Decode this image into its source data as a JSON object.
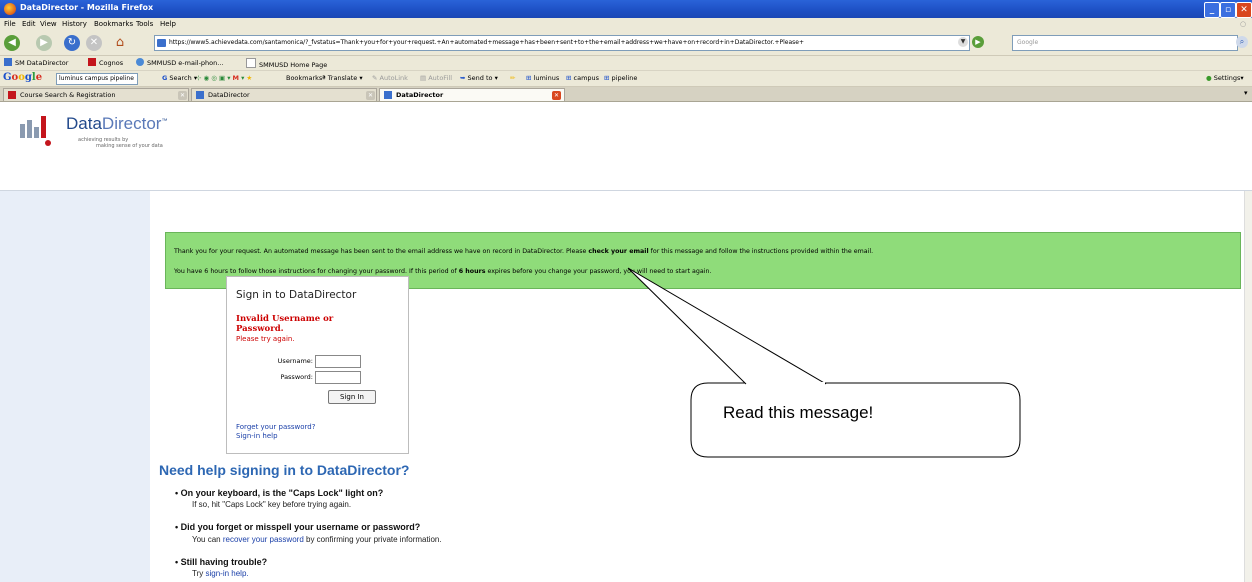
{
  "window": {
    "title": "DataDirector - Mozilla Firefox"
  },
  "menu": [
    "File",
    "Edit",
    "View",
    "History",
    "Bookmarks",
    "Tools",
    "Help"
  ],
  "nav": {
    "url": "https://www5.achievedata.com/santamonica/?_fvstatus=Thank+you+for+your+request.+An+automated+message+has+been+sent+to+the+email+address+we+have+on+record+in+DataDirector.+Please+",
    "search_placeholder": "Google"
  },
  "bookmarks": [
    "SM DataDirector",
    "Cognos",
    "SMMUSD e-mail-phon...",
    "SMMUSD Home Page"
  ],
  "google_toolbar": {
    "logo": "Google",
    "query": "luminus campus pipeline",
    "items": [
      "Search",
      "Bookmarks",
      "Translate",
      "AutoLink",
      "AutoFill",
      "Send to",
      "luminus",
      "campus",
      "pipeline"
    ],
    "settings": "Settings"
  },
  "tabs": [
    {
      "label": "Course Search & Registration"
    },
    {
      "label": "DataDirector"
    },
    {
      "label": "DataDirector"
    }
  ],
  "header": {
    "brand_a": "Data",
    "brand_b": "Director",
    "tm": "™",
    "tagline_1": "achieving results by",
    "tagline_2": "making sense of your data"
  },
  "message": {
    "line1_a": "Thank you for your request. An automated message has been sent to the email address we have on record in DataDirector. Please ",
    "line1_b": "check your email",
    "line1_c": " for this message and follow the instructions provided within the email.",
    "line2_a": "You have 6 hours to follow those instructions for changing your password. If this period of ",
    "line2_b": "6 hours",
    "line2_c": " expires before you change your password, you will need to start again."
  },
  "signin": {
    "heading": "Sign in to DataDirector",
    "error_1": "Invalid Username or",
    "error_2": "Password.",
    "try_again": "Please try again.",
    "username_label": "Username:",
    "password_label": "Password:",
    "button": "Sign In",
    "forgot": "Forget your password?",
    "help": "Sign-in help"
  },
  "help": {
    "heading": "Need help signing in to DataDirector?",
    "q1": "• On your keyboard, is the \"Caps Lock\" light on?",
    "a1": "If so, hit \"Caps Lock\" key before trying again.",
    "q2": "• Did you forget or misspell your username or password?",
    "a2_a": "You can ",
    "a2_link": "recover your password",
    "a2_b": " by confirming your private information.",
    "q3": "• Still having trouble?",
    "a3_a": "Try ",
    "a3_link": "sign-in help."
  },
  "callout": {
    "text": "Read this message!"
  }
}
